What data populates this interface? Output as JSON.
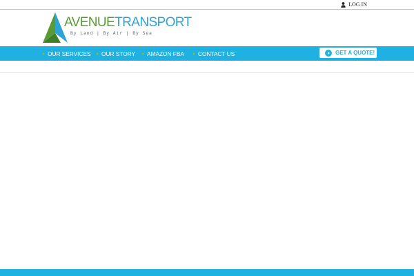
{
  "topbar": {
    "login_label": "LOG IN",
    "login_icon": "user-icon"
  },
  "logo": {
    "brand_part1": "AVENUE",
    "brand_part2": "TRANSPORT",
    "tagline": "By Land | By Air | By Sea",
    "colors": {
      "green": "#5a9a34",
      "blue": "#2fa3d8"
    }
  },
  "nav": {
    "items": [
      {
        "label": "OUR SERVICES"
      },
      {
        "label": "OUR STORY"
      },
      {
        "label": "AMAZON FBA"
      },
      {
        "label": "CONTACT US"
      }
    ],
    "bullet_color": "#7cc142",
    "background": "#1fb1e2"
  },
  "cta": {
    "label": "GET A QUOTE!",
    "icon": "play-icon"
  }
}
